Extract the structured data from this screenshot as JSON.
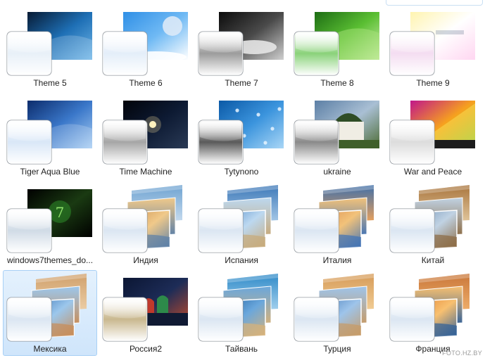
{
  "themes": [
    {
      "label": "Theme 5",
      "icon": "desktop-theme-icon",
      "kind": "blue-swoosh",
      "bg": [
        "#071a33",
        "#1e6fb5",
        "#6fb6e8"
      ],
      "bg2": [
        "#0a2544",
        "#2a7cc0"
      ],
      "swatch": "#e8f0f8",
      "selected": false
    },
    {
      "label": "Theme 6",
      "icon": "desktop-theme-icon",
      "kind": "sky-moon",
      "bg": [
        "#2f8fe6",
        "#6fb9f4",
        "#ffffff"
      ],
      "bg2": [
        "#5aa8ea",
        "#a7d6fa"
      ],
      "swatch": "#e4eef9",
      "selected": false
    },
    {
      "label": "Theme 7",
      "icon": "desktop-theme-icon",
      "kind": "car",
      "bg": [
        "#0b0b0b",
        "#4a4a4a",
        "#cfcfcf"
      ],
      "bg2": [
        "#1a1a1a",
        "#777777"
      ],
      "swatch": "#9c9c9c",
      "selected": false
    },
    {
      "label": "Theme 8",
      "icon": "desktop-theme-icon",
      "kind": "green",
      "bg": [
        "#1d6d14",
        "#5bbf33",
        "#d8f2b6"
      ],
      "bg2": [
        "#2b7e1a",
        "#8fd866"
      ],
      "swatch": "#8ad27a",
      "selected": false
    },
    {
      "label": "Theme 9",
      "icon": "desktop-theme-icon",
      "kind": "pastel",
      "bg": [
        "#fff4b0",
        "#ffffff",
        "#ffd6f1"
      ],
      "bg2": [
        "#ffe07a",
        "#ffd0ee"
      ],
      "swatch": "#f4ddf1",
      "selected": false
    },
    {
      "label": "Tiger Aqua Blue",
      "icon": "desktop-theme-icon",
      "kind": "aqua",
      "bg": [
        "#0c2c6c",
        "#3a77c9",
        "#a7cdf3"
      ],
      "bg2": [
        "#163f8e",
        "#5c98e2"
      ],
      "swatch": "#d9e7f7",
      "selected": false
    },
    {
      "label": "Time Machine",
      "icon": "desktop-theme-icon",
      "kind": "space",
      "bg": [
        "#02040a",
        "#0d1a33",
        "#2a3a55"
      ],
      "bg2": [
        "#0a0f1c",
        "#1b2638"
      ],
      "swatch": "#a6a6a6",
      "selected": false
    },
    {
      "label": "Tytynono",
      "icon": "desktop-theme-icon",
      "kind": "drops",
      "bg": [
        "#0b59a6",
        "#3b94dd",
        "#a9d6f6"
      ],
      "bg2": [
        "#1c6cb8",
        "#67b2ea"
      ],
      "swatch": "#5a5a5a",
      "selected": false
    },
    {
      "label": "ukraine",
      "icon": "desktop-theme-icon",
      "kind": "church",
      "bg": [
        "#5c7fa5",
        "#a9bfd4",
        "#4c6b33"
      ],
      "bg2": [
        "#7894b3",
        "#c9d8e6"
      ],
      "swatch": "#8a8a8a",
      "selected": false
    },
    {
      "label": "War and Peace",
      "icon": "desktop-theme-icon",
      "kind": "rainbow",
      "bg": [
        "#c0178a",
        "#f6a11e",
        "#7ac943"
      ],
      "bg2": [
        "#7d2fb0",
        "#f04a73"
      ],
      "swatch": "#dcdcdc",
      "selected": false
    },
    {
      "label": "windows7themes_do...",
      "icon": "desktop-theme-icon",
      "kind": "win7",
      "bg": [
        "#000000",
        "#1a3a12",
        "#000000"
      ],
      "bg2": [
        "#050505",
        "#0f2a0a"
      ],
      "swatch": "#d0dbe6",
      "selected": false
    },
    {
      "label": "Индия",
      "icon": "desktop-theme-icon",
      "kind": "stack",
      "bg": [
        "#c88a4a",
        "#f0c98a",
        "#5a7fa8"
      ],
      "bg2": [
        "#6fa3d1",
        "#c9ddf0"
      ],
      "swatch": "#dbe6f2",
      "selected": false
    },
    {
      "label": "Испания",
      "icon": "desktop-theme-icon",
      "kind": "stack",
      "bg": [
        "#4a87c8",
        "#bcd8f0",
        "#c8a978"
      ],
      "bg2": [
        "#3d78b8",
        "#a9cbe9"
      ],
      "swatch": "#dbe6f2",
      "selected": false
    },
    {
      "label": "Италия",
      "icon": "desktop-theme-icon",
      "kind": "stack",
      "bg": [
        "#d9874a",
        "#f2c27a",
        "#3f72b6"
      ],
      "bg2": [
        "#3f6fa9",
        "#f0a35a"
      ],
      "swatch": "#dbe6f2",
      "selected": false
    },
    {
      "label": "Китай",
      "icon": "desktop-theme-icon",
      "kind": "stack",
      "bg": [
        "#6b8fb4",
        "#c0d2e3",
        "#8b6a42"
      ],
      "bg2": [
        "#a9753d",
        "#e3c9a0"
      ],
      "swatch": "#dbe6f2",
      "selected": false
    },
    {
      "label": "Мексика",
      "icon": "desktop-theme-icon",
      "kind": "stack",
      "bg": [
        "#2f6bb0",
        "#9cc7ec",
        "#c98c56"
      ],
      "bg2": [
        "#d0a06b",
        "#eccfa8"
      ],
      "swatch": "#dbe6f2",
      "selected": true
    },
    {
      "label": "Россия2",
      "icon": "desktop-theme-icon",
      "kind": "moscow",
      "bg": [
        "#0b1633",
        "#1d2c57",
        "#c04a2a"
      ],
      "bg2": [
        "#0e1a3a",
        "#33467a"
      ],
      "swatch": "#c9b88f",
      "selected": false
    },
    {
      "label": "Тайвань",
      "icon": "desktop-theme-icon",
      "kind": "stack",
      "bg": [
        "#1a5a9a",
        "#6aa7dc",
        "#d8b278"
      ],
      "bg2": [
        "#2f8ac8",
        "#a8d3ef"
      ],
      "swatch": "#dbe6f2",
      "selected": false
    },
    {
      "label": "Турция",
      "icon": "desktop-theme-icon",
      "kind": "stack",
      "bg": [
        "#3e75b5",
        "#9ec4ea",
        "#c79a64"
      ],
      "bg2": [
        "#d69b58",
        "#f2cf98"
      ],
      "swatch": "#dbe6f2",
      "selected": false
    },
    {
      "label": "Франция",
      "icon": "desktop-theme-icon",
      "kind": "stack",
      "bg": [
        "#e07b2a",
        "#f8c070",
        "#2f5f99"
      ],
      "bg2": [
        "#c9773a",
        "#f0b06c"
      ],
      "swatch": "#dbe6f2",
      "selected": false
    }
  ],
  "watermark": "FOTO.HZ.BY"
}
